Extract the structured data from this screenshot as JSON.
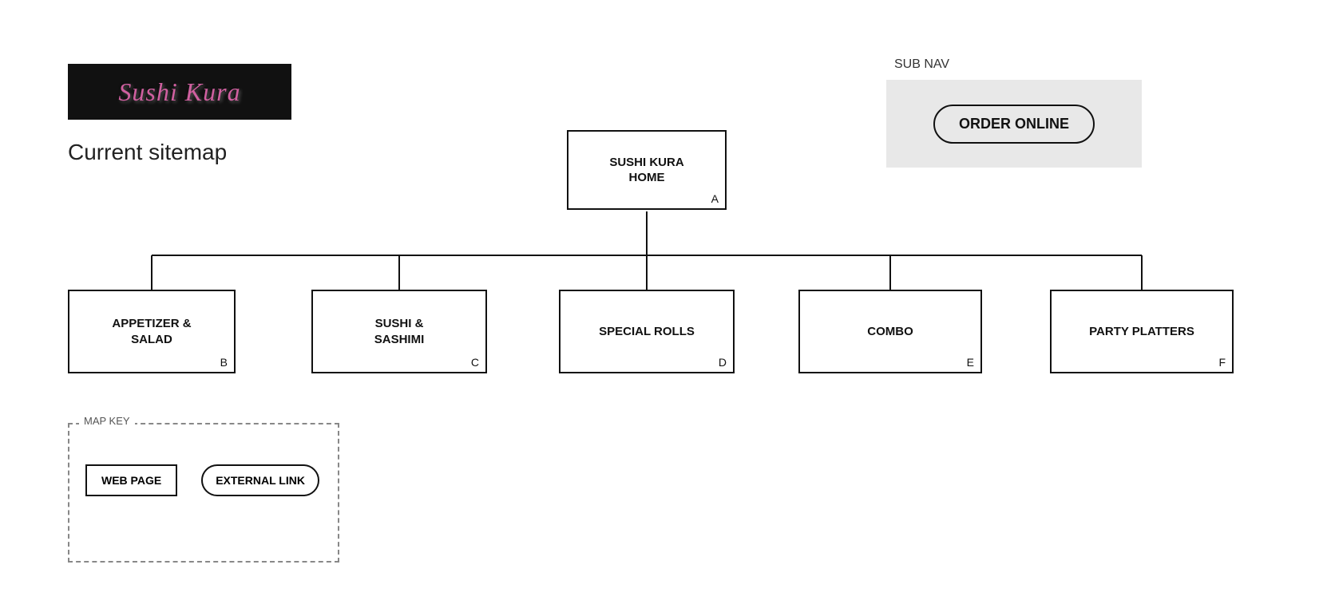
{
  "logo": {
    "text": "Sushi Kura"
  },
  "sitemap": {
    "title": "Current sitemap",
    "sub_nav_label": "SUB NAV",
    "nodes": {
      "home": {
        "id": "A",
        "label": "SUSHI KURA\nHOME"
      },
      "appetizer": {
        "id": "B",
        "label": "APPETIZER &\nSALAD"
      },
      "sushi": {
        "id": "C",
        "label": "SUSHI &\nSASHIMI"
      },
      "special_rolls": {
        "id": "D",
        "label": "SPECIAL ROLLS"
      },
      "combo": {
        "id": "E",
        "label": "COMBO"
      },
      "party_platters": {
        "id": "F",
        "label": "PARTY PLATTERS"
      },
      "order_online": {
        "label": "ORDER ONLINE"
      }
    }
  },
  "map_key": {
    "label": "MAP KEY",
    "web_page": "WEB PAGE",
    "external_link": "EXTERNAL LINK"
  }
}
